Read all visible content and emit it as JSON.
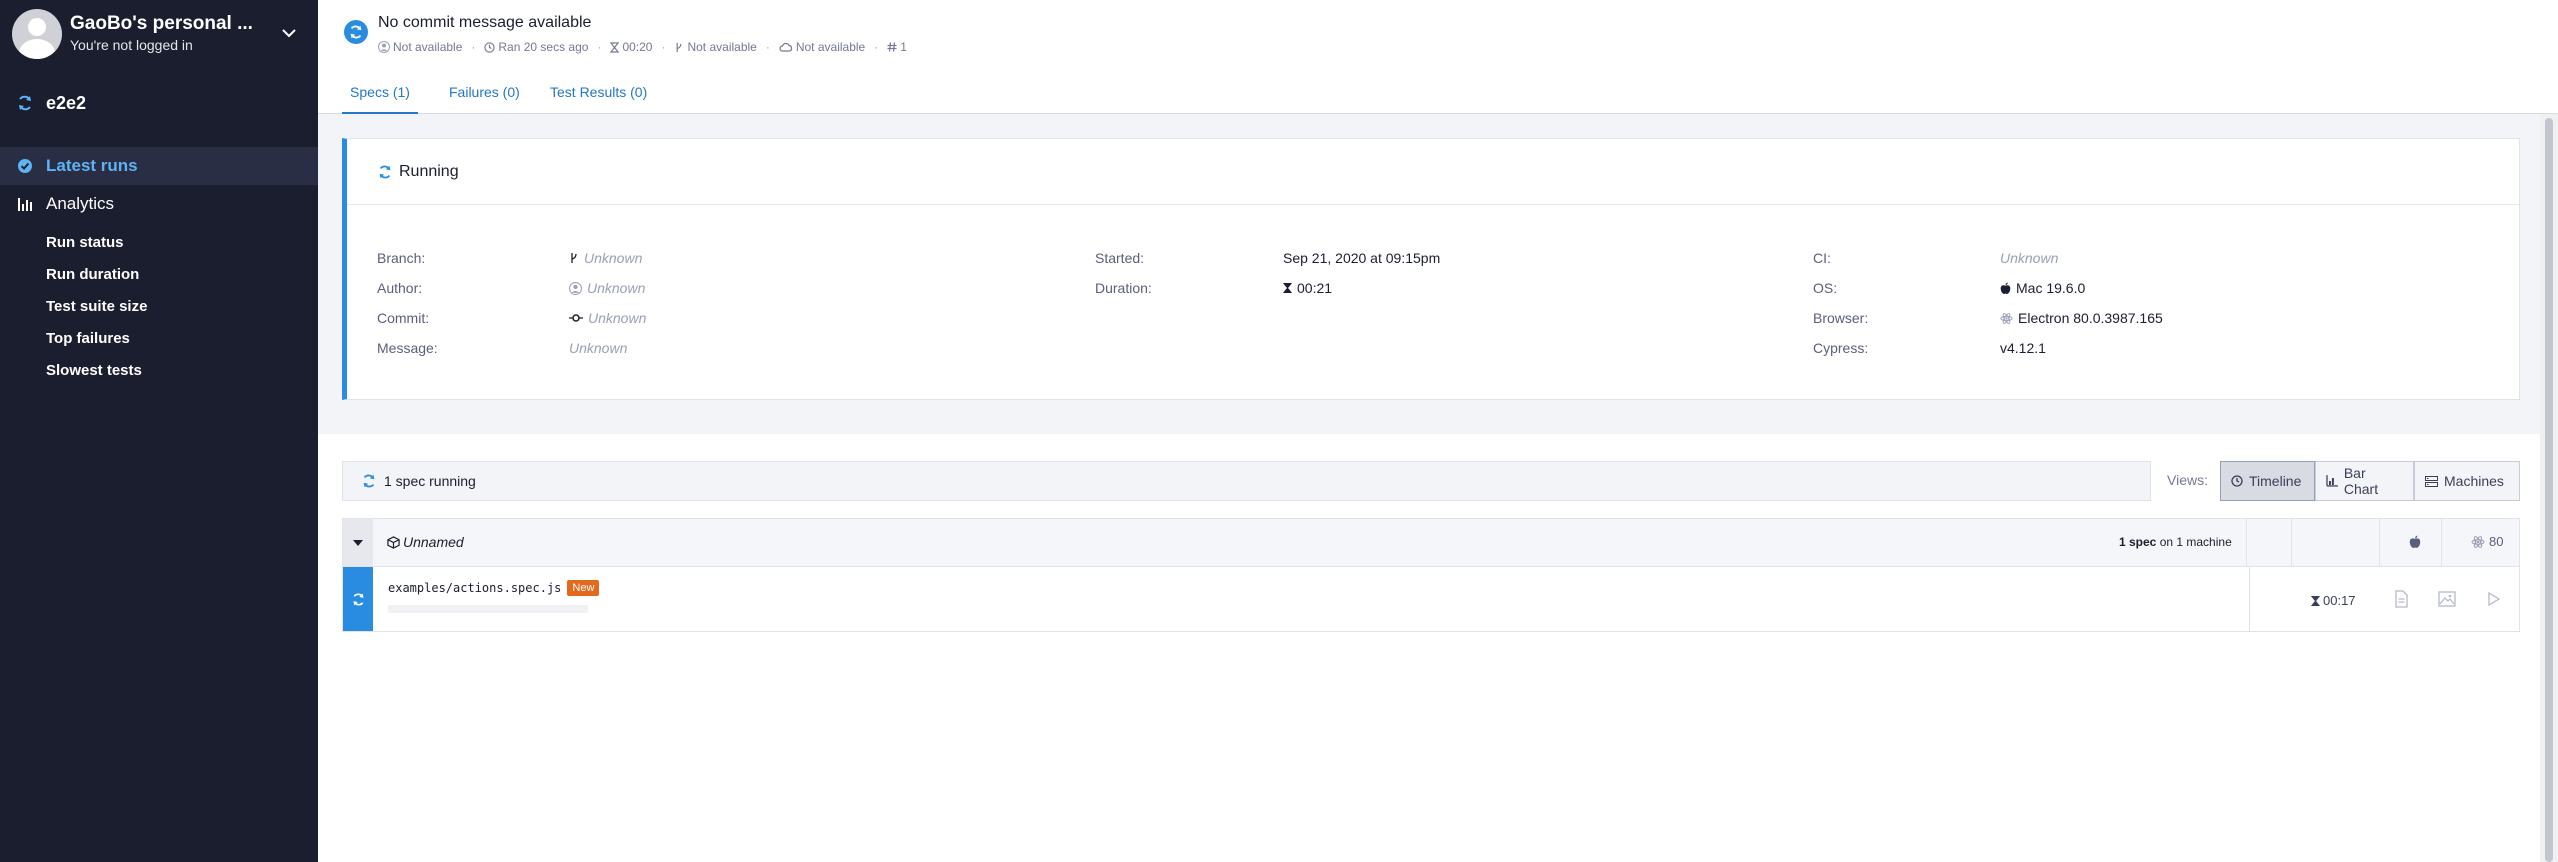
{
  "sidebar": {
    "org_name": "GaoBo's personal ...",
    "org_subtitle": "You're not logged in",
    "project_name": "e2e2",
    "nav": [
      {
        "label": "Latest runs",
        "icon": "check-circle-icon",
        "active": true
      },
      {
        "label": "Analytics",
        "icon": "bar-chart-icon",
        "active": false
      }
    ],
    "analytics_items": [
      "Run status",
      "Run duration",
      "Test suite size",
      "Top failures",
      "Slowest tests"
    ]
  },
  "header": {
    "commit_message": "No commit message available",
    "meta": {
      "author": "Not available",
      "ran_ago": "Ran 20 secs ago",
      "duration": "00:20",
      "branch": "Not available",
      "ci": "Not available",
      "run_number": "1"
    }
  },
  "tabs": [
    {
      "label": "Specs (1)",
      "active": true
    },
    {
      "label": "Failures (0)",
      "active": false
    },
    {
      "label": "Test Results (0)",
      "active": false
    }
  ],
  "status_card": {
    "status": "Running",
    "fields": {
      "branch": {
        "label": "Branch:",
        "value": "Unknown"
      },
      "author": {
        "label": "Author:",
        "value": "Unknown"
      },
      "commit": {
        "label": "Commit:",
        "value": "Unknown"
      },
      "message": {
        "label": "Message:",
        "value": "Unknown"
      },
      "started": {
        "label": "Started:",
        "value": "Sep 21, 2020 at 09:15pm"
      },
      "duration": {
        "label": "Duration:",
        "value": "00:21"
      },
      "ci": {
        "label": "CI:",
        "value": "Unknown"
      },
      "os": {
        "label": "OS:",
        "value": "Mac 19.6.0"
      },
      "browser": {
        "label": "Browser:",
        "value": "Electron 80.0.3987.165"
      },
      "cypress": {
        "label": "Cypress:",
        "value": "v4.12.1"
      }
    }
  },
  "specs_summary": "1 spec running",
  "views": {
    "label": "Views:",
    "options": [
      {
        "label": "Timeline",
        "active": true
      },
      {
        "label": "Bar Chart",
        "active": false
      },
      {
        "label": "Machines",
        "active": false
      }
    ]
  },
  "group": {
    "name": "Unnamed",
    "count_strong": "1 spec",
    "count_rest": " on 1 machine",
    "browser_version": "80"
  },
  "spec": {
    "path": "examples/actions.spec.js",
    "badge": "New",
    "duration": "00:17"
  },
  "colors": {
    "sidebar_bg": "#1b1e2e",
    "accent_blue": "#2a8ce0",
    "link_blue": "#2377c8",
    "badge_orange": "#e36a1c"
  }
}
